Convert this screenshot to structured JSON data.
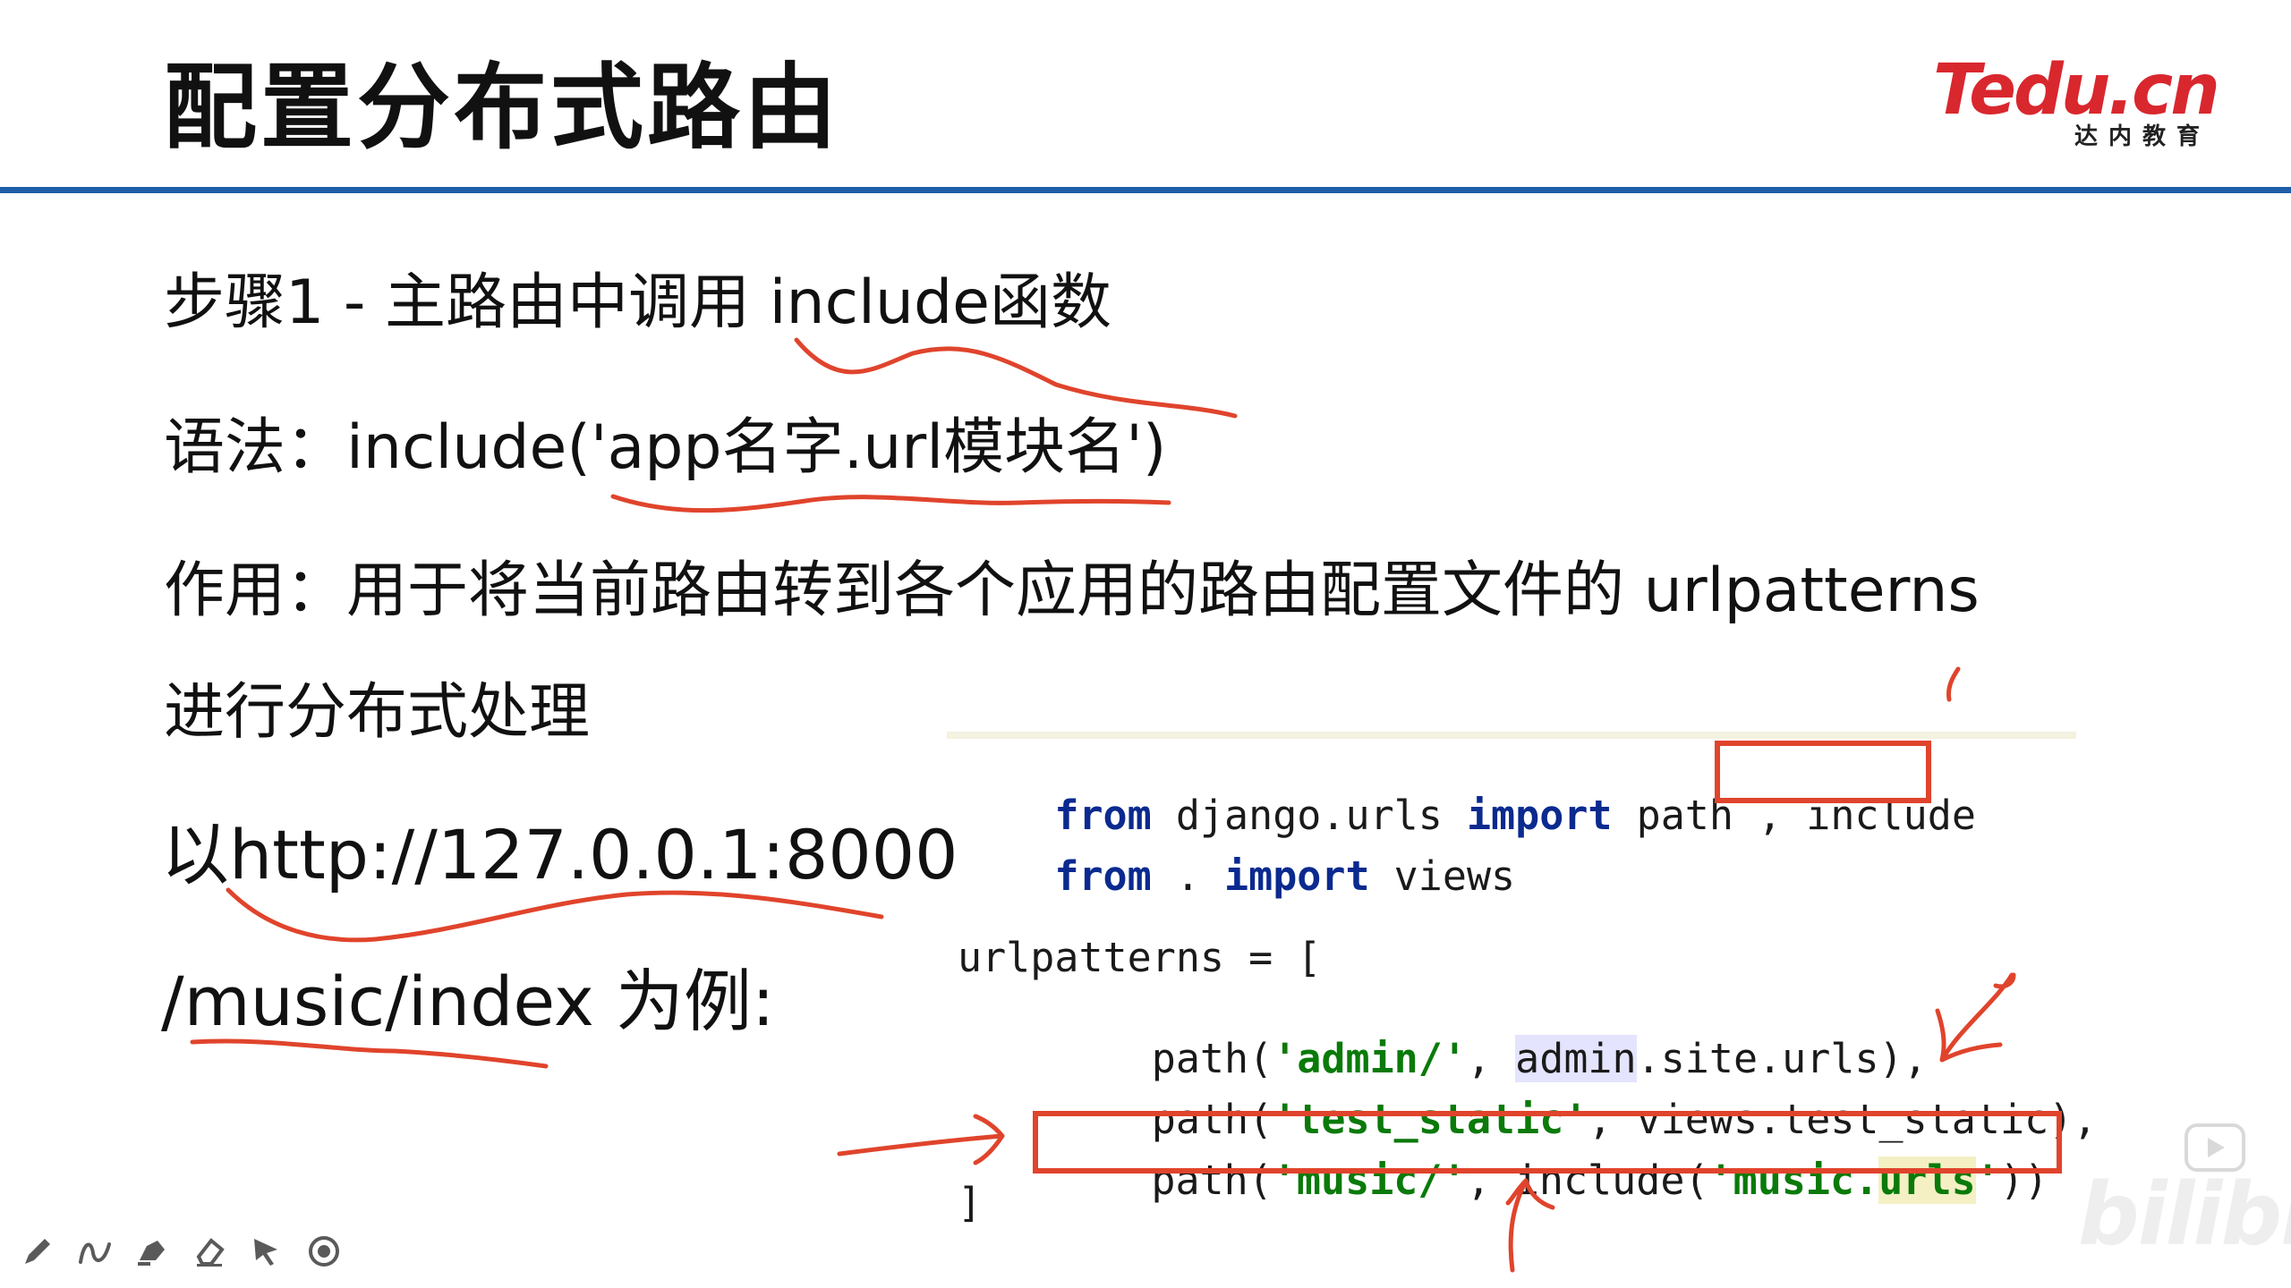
{
  "slide": {
    "title": "配置分布式路由",
    "logo": {
      "brand": "Tedu.cn",
      "subtitle": "达内教育",
      "colors": [
        "#d9272e",
        "#1f5fa8"
      ]
    },
    "accent": "#1f5fa8"
  },
  "content": {
    "step": "步骤1 - 主路由中调用 include函数",
    "syntax": "语法：include('app名字.url模块名')",
    "purpose_line1": "作用：用于将当前路由转到各个应用的路由配置文件的 urlpatterns",
    "purpose_line2": "进行分布式处理",
    "example_line1": "以http://127.0.0.1:8000",
    "example_line2": "/music/index 为例:"
  },
  "code": {
    "l1": {
      "kw1": "from",
      "mod": " django.urls ",
      "kw2": "import",
      "rest": " path",
      "comma": " , ",
      "include": "include"
    },
    "l2": {
      "kw1": "from",
      "mod": " . ",
      "kw2": "import",
      "rest": " views"
    },
    "l3": {
      "text": "urlpatterns = ["
    },
    "l4": {
      "indent": "    path(",
      "s1": "'admin/'",
      "sep": ", ",
      "admin": "admin",
      "rest": ".site.urls),"
    },
    "l5": {
      "indent": "    path(",
      "s1": "'test_static'",
      "rest": ", views.test_static),"
    },
    "l6": {
      "indent": "path(",
      "s1": "'music/'",
      "mid": ", include(",
      "s2a": "'music.",
      "s2b": "urls",
      "s2c": "'",
      "end": "))"
    },
    "l7": {
      "text": "]"
    }
  },
  "colors": {
    "keyword": "#0b2a8f",
    "string": "#0a7a0a",
    "annotation": "#e0442c"
  },
  "toolbar": [
    "pen-icon",
    "curve-icon",
    "highlighter-icon",
    "eraser-icon",
    "pointer-icon",
    "record-icon"
  ],
  "watermark": "bilibili"
}
